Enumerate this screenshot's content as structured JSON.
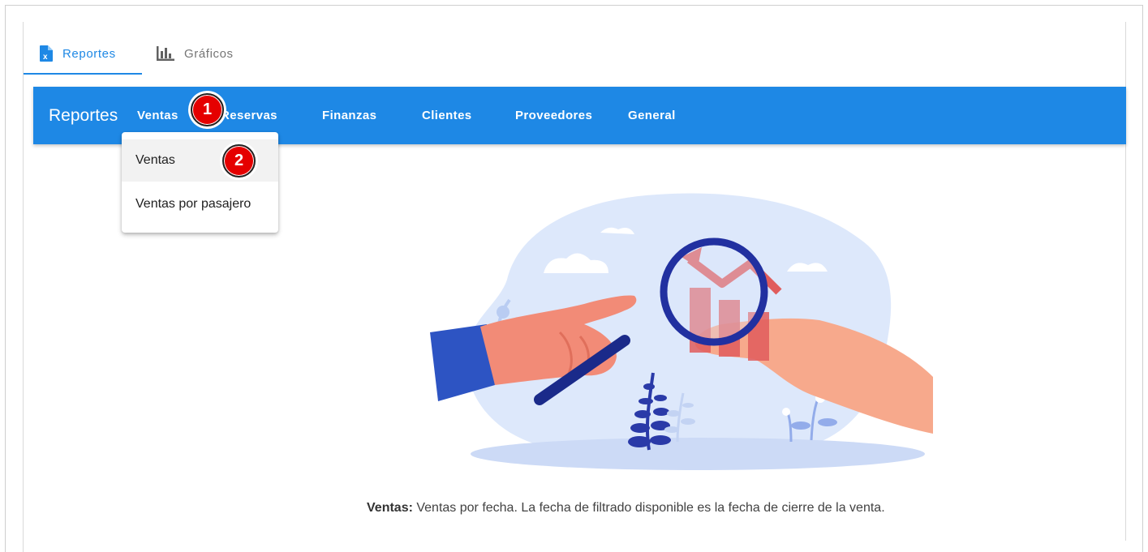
{
  "tabs": {
    "reportes": {
      "label": "Reportes",
      "icon": "excel-file-icon",
      "active": true
    },
    "graficos": {
      "label": "Gráficos",
      "icon": "bar-chart-icon",
      "active": false
    }
  },
  "appbar": {
    "title": "Reportes",
    "menu": [
      {
        "label": "Ventas"
      },
      {
        "label": "Reservas"
      },
      {
        "label": "Finanzas"
      },
      {
        "label": "Clientes"
      },
      {
        "label": "Proveedores"
      },
      {
        "label": "General"
      }
    ]
  },
  "dropdown": {
    "items": [
      {
        "label": "Ventas"
      },
      {
        "label": "Ventas por pasajero"
      }
    ]
  },
  "annotations": {
    "step1": "1",
    "step2": "2"
  },
  "description": {
    "heading": "Ventas:",
    "text": " Ventas por fecha. La fecha de filtrado disponible es la fecha de cierre de la venta."
  },
  "colors": {
    "primary": "#1e88e5",
    "badge": "#e50000"
  }
}
